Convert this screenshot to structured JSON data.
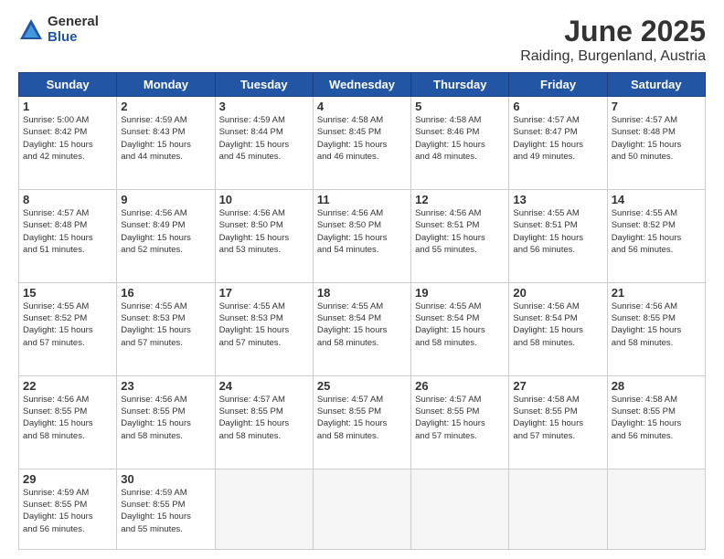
{
  "logo": {
    "general": "General",
    "blue": "Blue"
  },
  "title": "June 2025",
  "location": "Raiding, Burgenland, Austria",
  "weekdays": [
    "Sunday",
    "Monday",
    "Tuesday",
    "Wednesday",
    "Thursday",
    "Friday",
    "Saturday"
  ],
  "weeks": [
    [
      {
        "day": "1",
        "sunrise": "5:00 AM",
        "sunset": "8:42 PM",
        "daylight": "15 hours and 42 minutes."
      },
      {
        "day": "2",
        "sunrise": "4:59 AM",
        "sunset": "8:43 PM",
        "daylight": "15 hours and 44 minutes."
      },
      {
        "day": "3",
        "sunrise": "4:59 AM",
        "sunset": "8:44 PM",
        "daylight": "15 hours and 45 minutes."
      },
      {
        "day": "4",
        "sunrise": "4:58 AM",
        "sunset": "8:45 PM",
        "daylight": "15 hours and 46 minutes."
      },
      {
        "day": "5",
        "sunrise": "4:58 AM",
        "sunset": "8:46 PM",
        "daylight": "15 hours and 48 minutes."
      },
      {
        "day": "6",
        "sunrise": "4:57 AM",
        "sunset": "8:47 PM",
        "daylight": "15 hours and 49 minutes."
      },
      {
        "day": "7",
        "sunrise": "4:57 AM",
        "sunset": "8:48 PM",
        "daylight": "15 hours and 50 minutes."
      }
    ],
    [
      {
        "day": "8",
        "sunrise": "4:57 AM",
        "sunset": "8:48 PM",
        "daylight": "15 hours and 51 minutes."
      },
      {
        "day": "9",
        "sunrise": "4:56 AM",
        "sunset": "8:49 PM",
        "daylight": "15 hours and 52 minutes."
      },
      {
        "day": "10",
        "sunrise": "4:56 AM",
        "sunset": "8:50 PM",
        "daylight": "15 hours and 53 minutes."
      },
      {
        "day": "11",
        "sunrise": "4:56 AM",
        "sunset": "8:50 PM",
        "daylight": "15 hours and 54 minutes."
      },
      {
        "day": "12",
        "sunrise": "4:56 AM",
        "sunset": "8:51 PM",
        "daylight": "15 hours and 55 minutes."
      },
      {
        "day": "13",
        "sunrise": "4:55 AM",
        "sunset": "8:51 PM",
        "daylight": "15 hours and 56 minutes."
      },
      {
        "day": "14",
        "sunrise": "4:55 AM",
        "sunset": "8:52 PM",
        "daylight": "15 hours and 56 minutes."
      }
    ],
    [
      {
        "day": "15",
        "sunrise": "4:55 AM",
        "sunset": "8:52 PM",
        "daylight": "15 hours and 57 minutes."
      },
      {
        "day": "16",
        "sunrise": "4:55 AM",
        "sunset": "8:53 PM",
        "daylight": "15 hours and 57 minutes."
      },
      {
        "day": "17",
        "sunrise": "4:55 AM",
        "sunset": "8:53 PM",
        "daylight": "15 hours and 57 minutes."
      },
      {
        "day": "18",
        "sunrise": "4:55 AM",
        "sunset": "8:54 PM",
        "daylight": "15 hours and 58 minutes."
      },
      {
        "day": "19",
        "sunrise": "4:55 AM",
        "sunset": "8:54 PM",
        "daylight": "15 hours and 58 minutes."
      },
      {
        "day": "20",
        "sunrise": "4:56 AM",
        "sunset": "8:54 PM",
        "daylight": "15 hours and 58 minutes."
      },
      {
        "day": "21",
        "sunrise": "4:56 AM",
        "sunset": "8:55 PM",
        "daylight": "15 hours and 58 minutes."
      }
    ],
    [
      {
        "day": "22",
        "sunrise": "4:56 AM",
        "sunset": "8:55 PM",
        "daylight": "15 hours and 58 minutes."
      },
      {
        "day": "23",
        "sunrise": "4:56 AM",
        "sunset": "8:55 PM",
        "daylight": "15 hours and 58 minutes."
      },
      {
        "day": "24",
        "sunrise": "4:57 AM",
        "sunset": "8:55 PM",
        "daylight": "15 hours and 58 minutes."
      },
      {
        "day": "25",
        "sunrise": "4:57 AM",
        "sunset": "8:55 PM",
        "daylight": "15 hours and 58 minutes."
      },
      {
        "day": "26",
        "sunrise": "4:57 AM",
        "sunset": "8:55 PM",
        "daylight": "15 hours and 57 minutes."
      },
      {
        "day": "27",
        "sunrise": "4:58 AM",
        "sunset": "8:55 PM",
        "daylight": "15 hours and 57 minutes."
      },
      {
        "day": "28",
        "sunrise": "4:58 AM",
        "sunset": "8:55 PM",
        "daylight": "15 hours and 56 minutes."
      }
    ],
    [
      {
        "day": "29",
        "sunrise": "4:59 AM",
        "sunset": "8:55 PM",
        "daylight": "15 hours and 56 minutes."
      },
      {
        "day": "30",
        "sunrise": "4:59 AM",
        "sunset": "8:55 PM",
        "daylight": "15 hours and 55 minutes."
      },
      null,
      null,
      null,
      null,
      null
    ]
  ]
}
